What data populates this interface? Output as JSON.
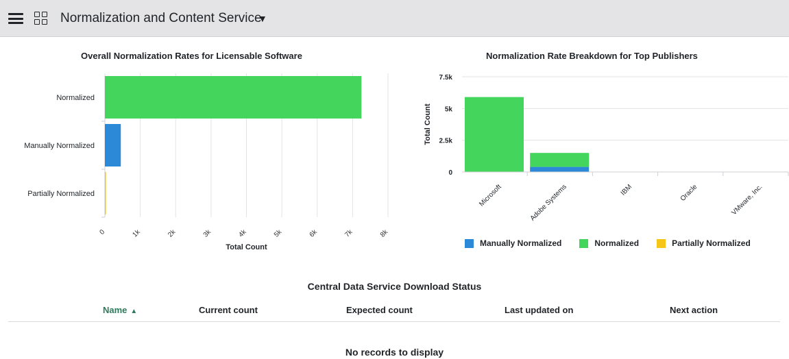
{
  "header": {
    "menu_icon": "hamburger-menu-icon",
    "apps_icon": "grid-apps-icon",
    "title": "Normalization and Content Service",
    "caret": "▼"
  },
  "left_chart": {
    "title": "Overall Normalization Rates for Licensable Software",
    "xlabel": "Total Count"
  },
  "right_chart": {
    "title": "Normalization Rate Breakdown for Top Publishers",
    "ylabel": "Total Count",
    "legend": [
      {
        "label": "Manually Normalized",
        "color": "#2b89d8"
      },
      {
        "label": "Normalized",
        "color": "#44d55d"
      },
      {
        "label": "Partially Normalized",
        "color": "#f5c518"
      }
    ]
  },
  "chart_data": [
    {
      "type": "bar",
      "orientation": "horizontal",
      "title": "Overall Normalization Rates for Licensable Software",
      "categories": [
        "Normalized",
        "Manually Normalized",
        "Partially Normalized"
      ],
      "values": [
        7250,
        450,
        30
      ],
      "colors": [
        "#44d55d",
        "#2b89d8",
        "#f5c518"
      ],
      "xlabel": "Total Count",
      "ylabel": "",
      "xlim": [
        0,
        8000
      ],
      "xticks": [
        0,
        1000,
        2000,
        3000,
        4000,
        5000,
        6000,
        7000,
        8000
      ],
      "xtick_labels": [
        "0",
        "1k",
        "2k",
        "3k",
        "4k",
        "5k",
        "6k",
        "7k",
        "8k"
      ],
      "grid": true
    },
    {
      "type": "bar",
      "stacked": true,
      "title": "Normalization Rate Breakdown for Top Publishers",
      "categories": [
        "Microsoft",
        "Adobe Systems",
        "IBM",
        "Oracle",
        "VMware, Inc."
      ],
      "series": [
        {
          "name": "Manually Normalized",
          "color": "#2b89d8",
          "values": [
            0,
            400,
            0,
            0,
            0
          ]
        },
        {
          "name": "Normalized",
          "color": "#44d55d",
          "values": [
            5900,
            1100,
            0,
            0,
            0
          ]
        },
        {
          "name": "Partially Normalized",
          "color": "#f5c518",
          "values": [
            0,
            0,
            0,
            0,
            0
          ]
        }
      ],
      "xlabel": "",
      "ylabel": "Total Count",
      "ylim": [
        0,
        7500
      ],
      "yticks": [
        0,
        2500,
        5000,
        7500
      ],
      "ytick_labels": [
        "0",
        "2.5k",
        "5k",
        "7.5k"
      ],
      "legend": "bottom",
      "grid": true
    }
  ],
  "table": {
    "title": "Central Data Service Download Status",
    "columns": [
      {
        "label": "Name",
        "sort": "▲"
      },
      {
        "label": "Current count"
      },
      {
        "label": "Expected count"
      },
      {
        "label": "Last updated on"
      },
      {
        "label": "Next action"
      }
    ],
    "empty_message": "No records to display"
  }
}
